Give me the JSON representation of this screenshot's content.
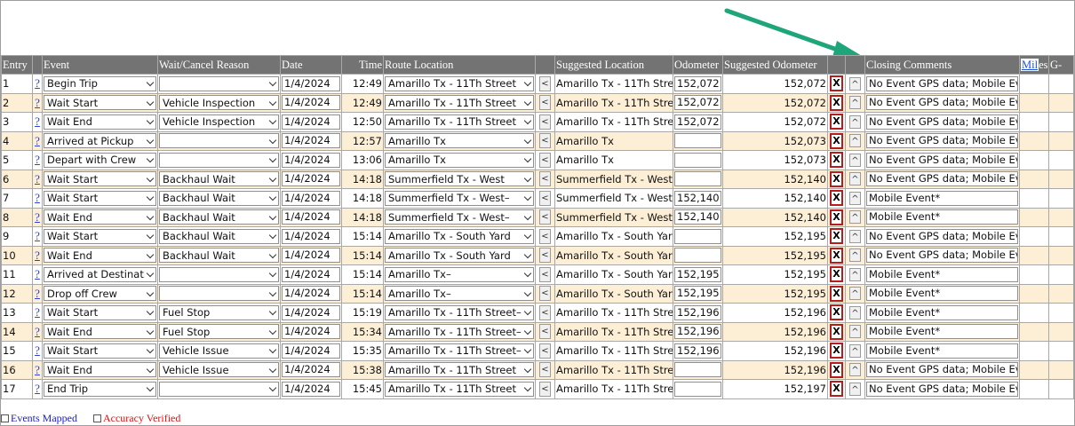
{
  "headers": {
    "entry": "Entry",
    "event": "Event",
    "wait_reason": "Wait/Cancel Reason",
    "date": "Date",
    "time": "Time",
    "route_location": "Route Location",
    "suggested_location": "Suggested Location",
    "odometer": "Odometer",
    "suggested_odometer": "Suggested Odometer",
    "closing_comments": "Closing Comments",
    "miles_link": "Mil",
    "miles_rest": "es",
    "g": "G-"
  },
  "row_buttons": {
    "help": "?",
    "copy_left": "<",
    "delete": "X",
    "move_up": "^"
  },
  "rows": [
    {
      "entry": "1",
      "event": "Begin Trip",
      "reason": "",
      "date": "1/4/2024",
      "time": "12:49",
      "route": "Amarillo Tx - 11Th Street",
      "suggested": "Amarillo Tx - 11Th Stree",
      "odometer": "152,072",
      "sugg_odo": "152,072",
      "comment": "No Event GPS data; Mobile Even"
    },
    {
      "entry": "2",
      "event": "Wait Start",
      "reason": "Vehicle Inspection",
      "date": "1/4/2024",
      "time": "12:49",
      "route": "Amarillo Tx - 11Th Street",
      "suggested": "Amarillo Tx - 11Th Stree",
      "odometer": "152,072",
      "sugg_odo": "152,072",
      "comment": "No Event GPS data; Mobile Even"
    },
    {
      "entry": "3",
      "event": "Wait End",
      "reason": "Vehicle Inspection",
      "date": "1/4/2024",
      "time": "12:50",
      "route": "Amarillo Tx - 11Th Street",
      "suggested": "Amarillo Tx - 11Th Stree",
      "odometer": "152,072",
      "sugg_odo": "152,072",
      "comment": "No Event GPS data; Mobile Even"
    },
    {
      "entry": "4",
      "event": "Arrived at Pickup",
      "reason": "",
      "date": "1/4/2024",
      "time": "12:57",
      "route": "Amarillo Tx",
      "suggested": "Amarillo Tx",
      "odometer": "",
      "sugg_odo": "152,073",
      "comment": "No Event GPS data; Mobile Even"
    },
    {
      "entry": "5",
      "event": "Depart with Crew",
      "reason": "",
      "date": "1/4/2024",
      "time": "13:06",
      "route": "Amarillo Tx",
      "suggested": "Amarillo Tx",
      "odometer": "",
      "sugg_odo": "152,073",
      "comment": "No Event GPS data; Mobile Even"
    },
    {
      "entry": "6",
      "event": "Wait Start",
      "reason": "Backhaul Wait",
      "date": "1/4/2024",
      "time": "14:18",
      "route": "Summerfield Tx - West",
      "suggested": "Summerfield Tx - West",
      "odometer": "",
      "sugg_odo": "152,140",
      "comment": "No Event GPS data; Mobile Even"
    },
    {
      "entry": "7",
      "event": "Wait Start",
      "reason": "Backhaul Wait",
      "date": "1/4/2024",
      "time": "14:18",
      "route": "Summerfield Tx - West–",
      "suggested": "Summerfield Tx - West",
      "odometer": "152,140",
      "sugg_odo": "152,140",
      "comment": "Mobile Event*"
    },
    {
      "entry": "8",
      "event": "Wait End",
      "reason": "Backhaul Wait",
      "date": "1/4/2024",
      "time": "14:18",
      "route": "Summerfield Tx - West–",
      "suggested": "Summerfield Tx - West",
      "odometer": "152,140",
      "sugg_odo": "152,140",
      "comment": "Mobile Event*"
    },
    {
      "entry": "9",
      "event": "Wait Start",
      "reason": "Backhaul Wait",
      "date": "1/4/2024",
      "time": "15:14",
      "route": "Amarillo Tx - South Yard",
      "suggested": "Amarillo Tx - South Yard",
      "odometer": "",
      "sugg_odo": "152,195",
      "comment": "No Event GPS data; Mobile Even"
    },
    {
      "entry": "10",
      "event": "Wait End",
      "reason": "Backhaul Wait",
      "date": "1/4/2024",
      "time": "15:14",
      "route": "Amarillo Tx - South Yard",
      "suggested": "Amarillo Tx - South Yard",
      "odometer": "",
      "sugg_odo": "152,195",
      "comment": "No Event GPS data; Mobile Even"
    },
    {
      "entry": "11",
      "event": "Arrived at Destinatio",
      "reason": "",
      "date": "1/4/2024",
      "time": "15:14",
      "route": "Amarillo Tx–",
      "suggested": "Amarillo Tx - South Yard",
      "odometer": "152,195",
      "sugg_odo": "152,195",
      "comment": "Mobile Event*"
    },
    {
      "entry": "12",
      "event": "Drop off Crew",
      "reason": "",
      "date": "1/4/2024",
      "time": "15:14",
      "route": "Amarillo Tx–",
      "suggested": "Amarillo Tx - South Yard",
      "odometer": "152,195",
      "sugg_odo": "152,195",
      "comment": "Mobile Event*"
    },
    {
      "entry": "13",
      "event": "Wait Start",
      "reason": "Fuel Stop",
      "date": "1/4/2024",
      "time": "15:19",
      "route": "Amarillo Tx - 11Th Street–",
      "suggested": "Amarillo Tx - 11Th Stree",
      "odometer": "152,196",
      "sugg_odo": "152,196",
      "comment": "Mobile Event*"
    },
    {
      "entry": "14",
      "event": "Wait End",
      "reason": "Fuel Stop",
      "date": "1/4/2024",
      "time": "15:34",
      "route": "Amarillo Tx - 11Th Street–",
      "suggested": "Amarillo Tx - 11Th Street",
      "odometer": "152,196",
      "sugg_odo": "152,196",
      "comment": "Mobile Event*"
    },
    {
      "entry": "15",
      "event": "Wait Start",
      "reason": "Vehicle Issue",
      "date": "1/4/2024",
      "time": "15:35",
      "route": "Amarillo Tx - 11Th Street–",
      "suggested": "Amarillo Tx - 11Th Stree",
      "odometer": "152,196",
      "sugg_odo": "152,196",
      "comment": "Mobile Event*"
    },
    {
      "entry": "16",
      "event": "Wait End",
      "reason": "Vehicle Issue",
      "date": "1/4/2024",
      "time": "15:38",
      "route": "Amarillo Tx - 11Th Street",
      "suggested": "Amarillo Tx - 11Th Street",
      "odometer": "",
      "sugg_odo": "152,196",
      "comment": "No Event GPS data; Mobile Even"
    },
    {
      "entry": "17",
      "event": "End Trip",
      "reason": "",
      "date": "1/4/2024",
      "time": "15:45",
      "route": "Amarillo Tx - 11Th Street",
      "suggested": "Amarillo Tx - 11Th Stree",
      "odometer": "",
      "sugg_odo": "152,197",
      "comment": "No Event GPS data; Mobile Even"
    }
  ],
  "footer": {
    "events_mapped": "Events Mapped",
    "events_mapped_color": "#1a1acc",
    "accuracy_verified": "Accuracy Verified",
    "accuracy_verified_color": "#dd1111"
  },
  "colors": {
    "header_bg": "#737373",
    "row_alt_bg": "#fcefd6",
    "delete_border": "#b51c1c",
    "annotation_arrow": "#1fa57a"
  }
}
